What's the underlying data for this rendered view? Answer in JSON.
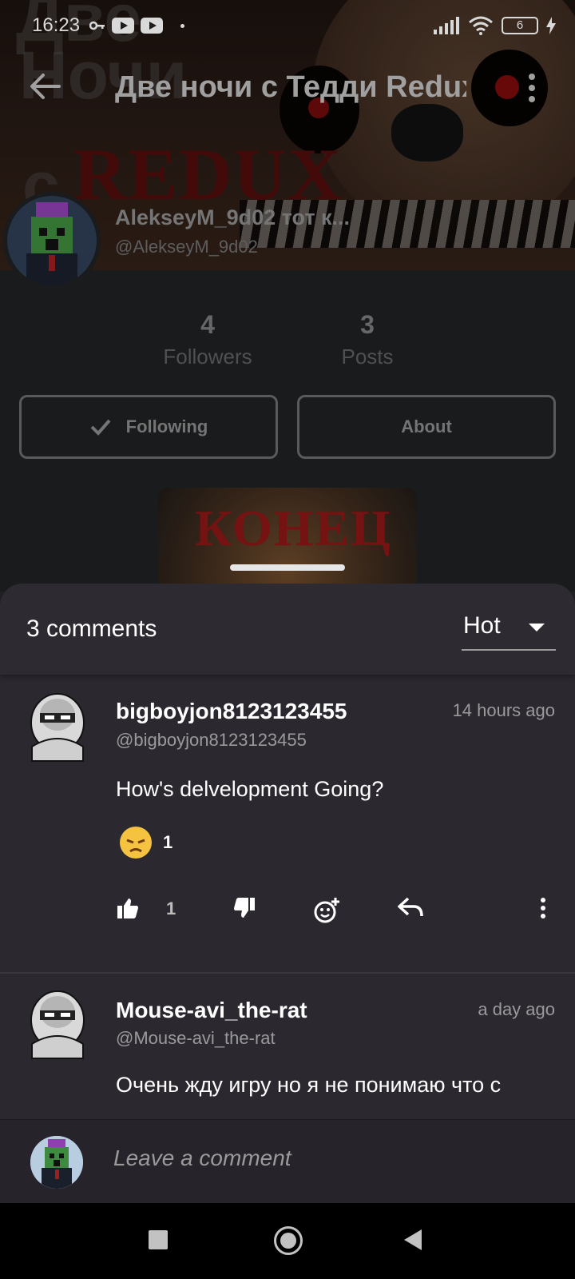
{
  "status_bar": {
    "time": "16:23",
    "battery": "6",
    "icons": [
      "key-icon",
      "youtube-icon",
      "youtube-icon",
      "dot-icon",
      "signal-icon",
      "wifi-icon",
      "battery-icon",
      "charging-icon"
    ]
  },
  "header": {
    "title": "Две ночи с Тедди Redux",
    "back_icon": "arrow-left-icon",
    "menu_icon": "more-vert-icon"
  },
  "profile": {
    "display_name": "AlekseyM_9d02 тот к...",
    "handle": "@AlekseyM_9d02",
    "stats": [
      {
        "value": "4",
        "label": "Followers"
      },
      {
        "value": "3",
        "label": "Posts"
      }
    ],
    "following_label": "Following",
    "about_label": "About"
  },
  "comments_sheet": {
    "count_label": "3 comments",
    "sort": {
      "selected": "Hot"
    },
    "comments": [
      {
        "username": "bigboyjon8123123455",
        "handle": "@bigboyjon8123123455",
        "time": "14 hours ago",
        "text": "How's delvelopment Going?",
        "reaction_count": "1",
        "like_count": "1"
      },
      {
        "username": "Mouse-avi_the-rat",
        "handle": "@Mouse-avi_the-rat",
        "time": "a day ago",
        "text": "Очень жду игру но я не понимаю что с"
      }
    ],
    "composer_placeholder": "Leave a comment"
  },
  "colors": {
    "sheet_bg": "#2b2830",
    "page_bg": "#1e2022",
    "accent_text": "#ffffff",
    "muted_text": "#9a9a9a"
  }
}
